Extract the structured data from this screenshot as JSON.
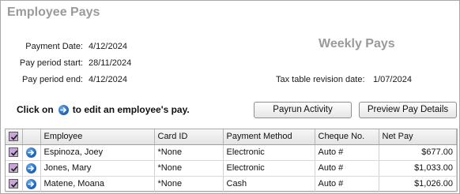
{
  "window": {
    "title": "Employee Pays"
  },
  "info": {
    "payment_date_label": "Payment Date:",
    "payment_date_value": "4/12/2024",
    "period_start_label": "Pay period start:",
    "period_start_value": "28/11/2024",
    "period_end_label": "Pay period end:",
    "period_end_value": "4/12/2024",
    "pays_type": "Weekly Pays",
    "tax_table_label": "Tax table revision date:",
    "tax_table_value": "1/07/2024"
  },
  "instruction": {
    "prefix": "Click on",
    "suffix": "to edit an employee's pay."
  },
  "buttons": {
    "payrun_activity": "Payrun Activity",
    "preview_pay_details": "Preview Pay Details"
  },
  "grid": {
    "columns": [
      "Employee",
      "Card ID",
      "Payment Method",
      "Cheque No.",
      "Net Pay"
    ],
    "rows": [
      {
        "checked": true,
        "employee": "Espinoza, Joey",
        "card_id": "*None",
        "payment_method": "Electronic",
        "cheque_no": "Auto #",
        "net_pay": "$677.00"
      },
      {
        "checked": true,
        "employee": "Jones, Mary",
        "card_id": "*None",
        "payment_method": "Electronic",
        "cheque_no": "Auto #",
        "net_pay": "$1,033.00"
      },
      {
        "checked": true,
        "employee": "Matene, Moana",
        "card_id": "*None",
        "payment_method": "Cash",
        "cheque_no": "Auto #",
        "net_pay": "$1,026.00"
      }
    ]
  },
  "colors": {
    "title_gray": "#9a9a9a",
    "check_fill": "#c8a6d8",
    "arrow_blue": "#1f5fb3"
  },
  "icons": {
    "row_select": "checkbox-checked-icon",
    "edit_pay": "blue-arrow-icon"
  }
}
